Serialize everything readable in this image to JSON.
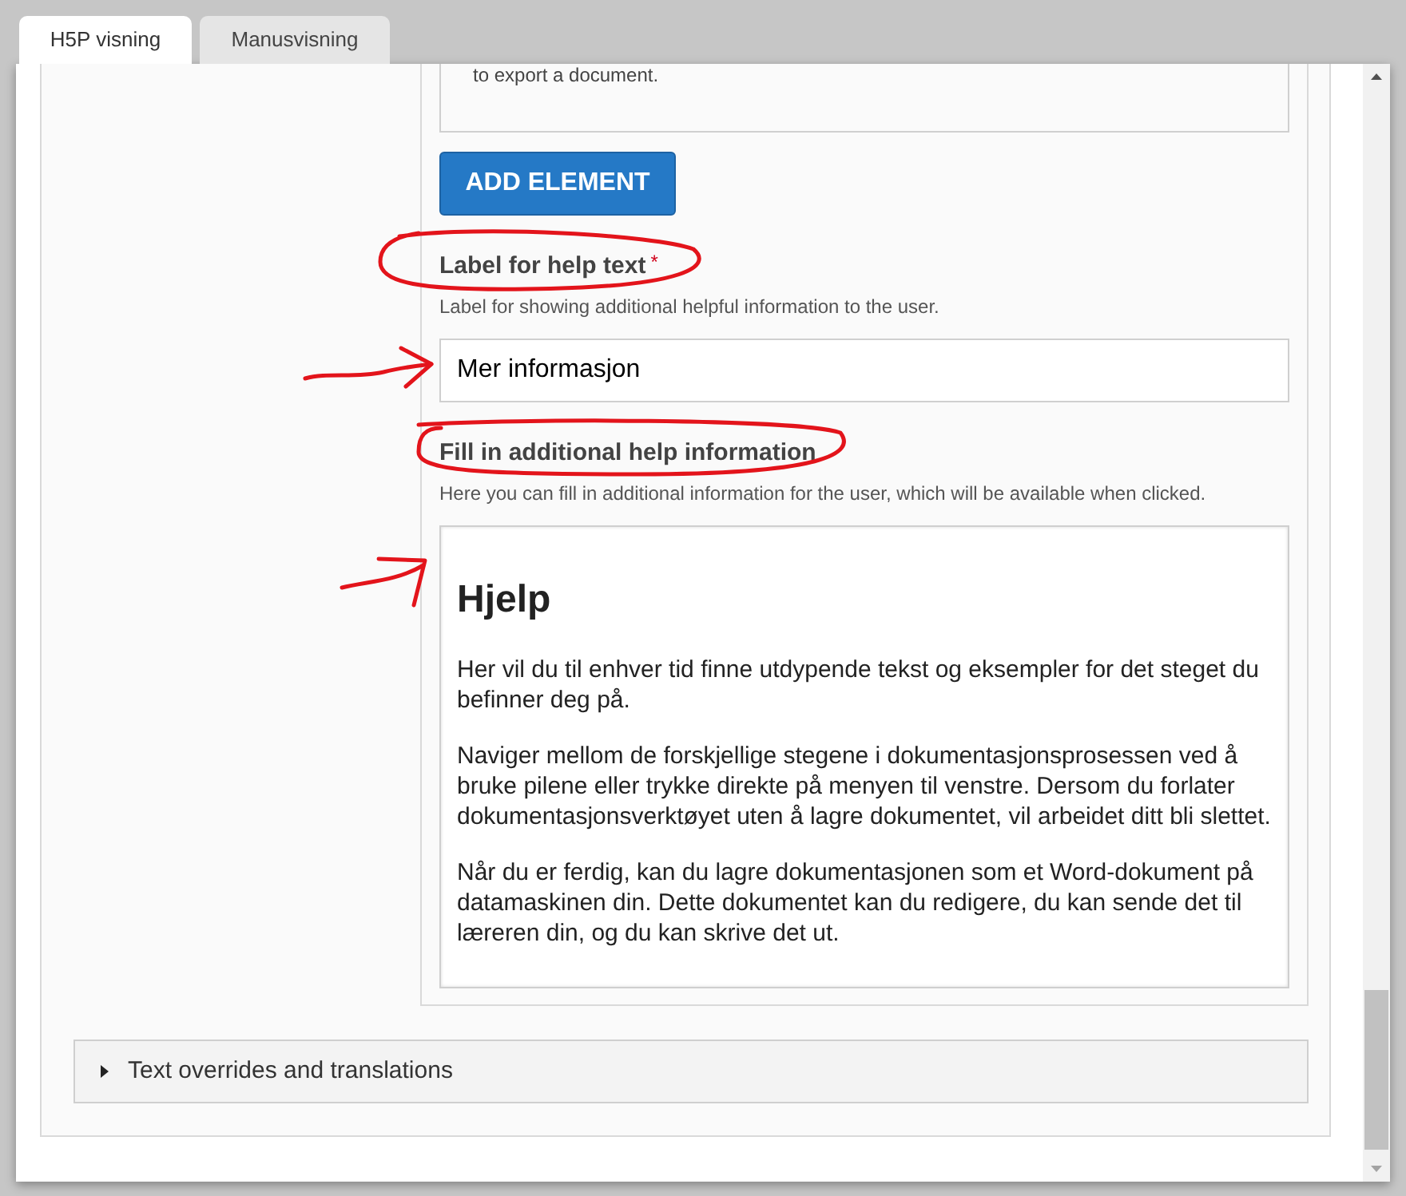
{
  "tabs": [
    {
      "label": "H5P visning",
      "selected": true
    },
    {
      "label": "Manusvisning",
      "selected": false
    }
  ],
  "list_item": {
    "text": "to export a document."
  },
  "add_button": {
    "label": "ADD ELEMENT"
  },
  "fields": [
    {
      "kind": "text",
      "label": "Label for help text",
      "required_mark": "*",
      "description": "Label for showing additional helpful information to the user.",
      "value": "Mer informasjon"
    },
    {
      "kind": "html",
      "label": "Fill in additional help information",
      "description": "Here you can fill in additional information for the user, which will be available when clicked.",
      "content": {
        "heading": "Hjelp",
        "paragraphs": [
          "Her vil du til enhver tid finne utdypende tekst og eksempler for det steget du befinner deg på.",
          "Naviger mellom de forskjellige stegene i dokumentasjonsprosessen ved å bruke pilene eller trykke direkte på menyen til venstre. Dersom du forlater dokumentasjonsverktøyet uten å lagre dokumentet, vil arbeidet ditt bli slettet.",
          "Når du er ferdig, kan du lagre dokumentasjonen som et Word-dokument på datamaskinen din. Dette dokumentet kan du redigere, du kan sende det til læreren din, og du kan skrive det ut."
        ]
      }
    }
  ],
  "collapsible": {
    "label": "Text overrides and translations",
    "expanded": false
  }
}
